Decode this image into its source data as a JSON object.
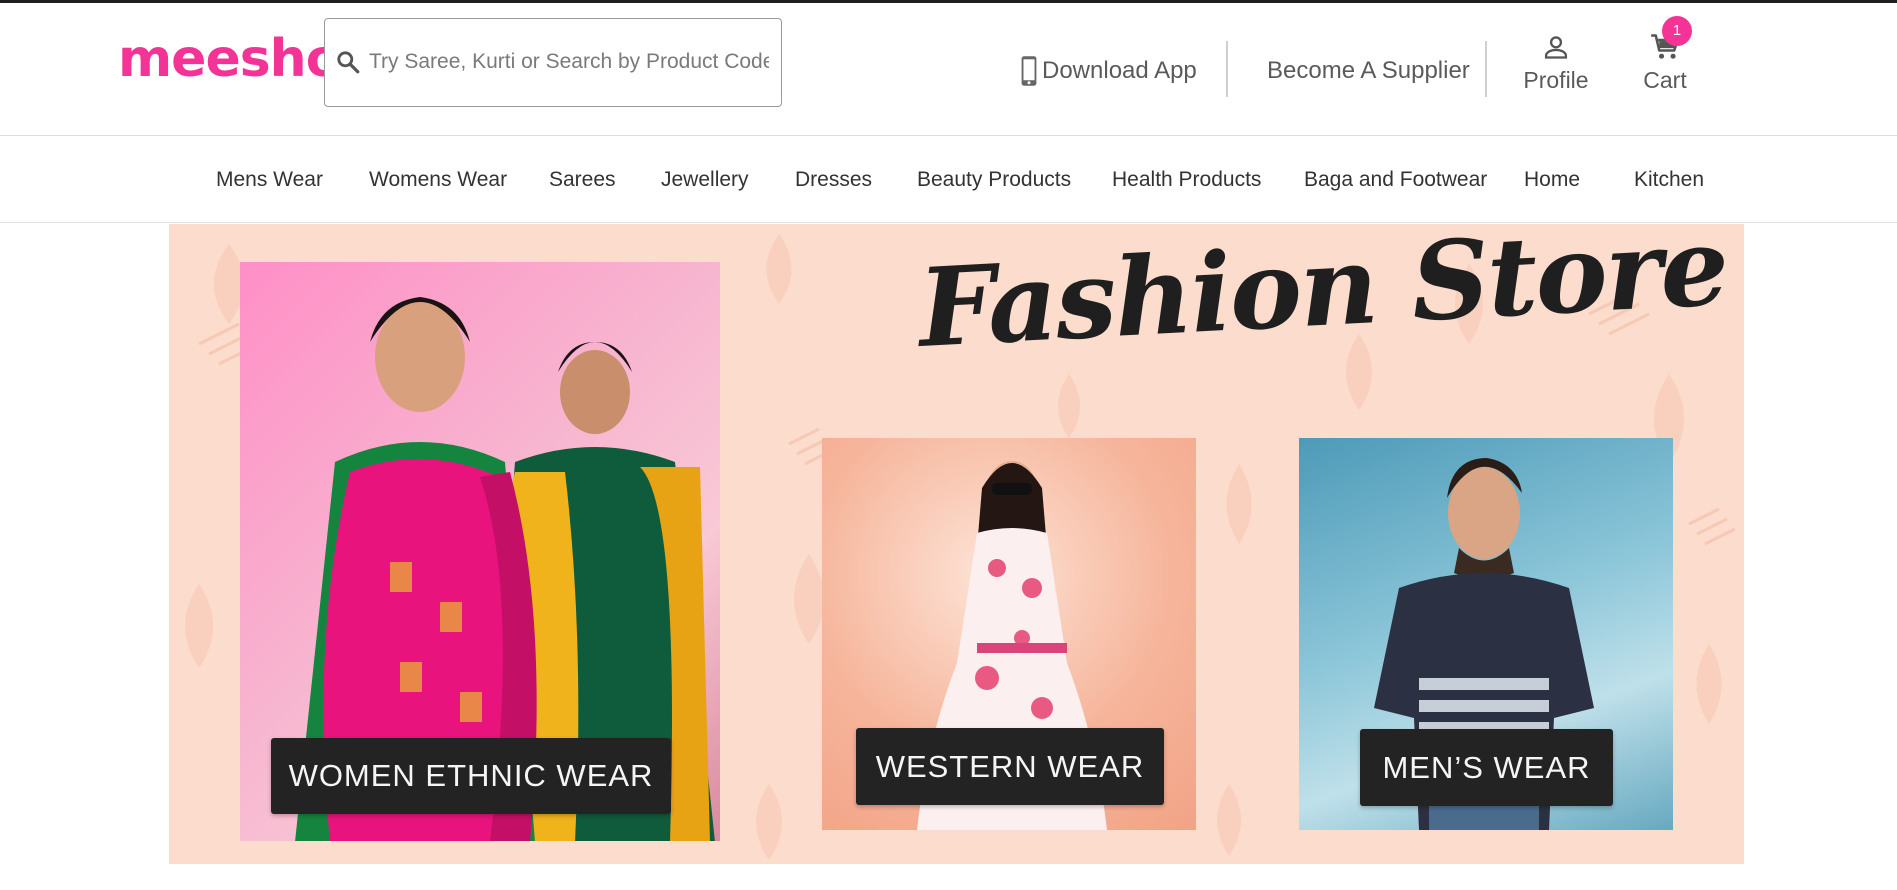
{
  "header": {
    "logo_text": "meesho",
    "search_placeholder": "Try Saree, Kurti or Search by Product Code",
    "download_app": "Download App",
    "become_supplier": "Become A Supplier",
    "profile": "Profile",
    "cart": "Cart",
    "cart_count": "1"
  },
  "categories": [
    "Mens Wear",
    "Womens Wear",
    "Sarees",
    "Jewellery",
    "Dresses",
    "Beauty Products",
    "Health Products",
    "Baga and Footwear",
    "Home",
    "Kitchen"
  ],
  "banner": {
    "title": "Fashion Store",
    "cards": [
      {
        "label": "WOMEN ETHNIC WEAR"
      },
      {
        "label": "WESTERN WEAR"
      },
      {
        "label": "MEN’S WEAR"
      }
    ]
  },
  "colors": {
    "brand": "#f43397",
    "banner_bg": "#fbdccd",
    "tag_bg": "#232323"
  },
  "icons": {
    "search": "search-icon",
    "download": "phone-icon",
    "profile": "user-icon",
    "cart": "cart-icon"
  }
}
